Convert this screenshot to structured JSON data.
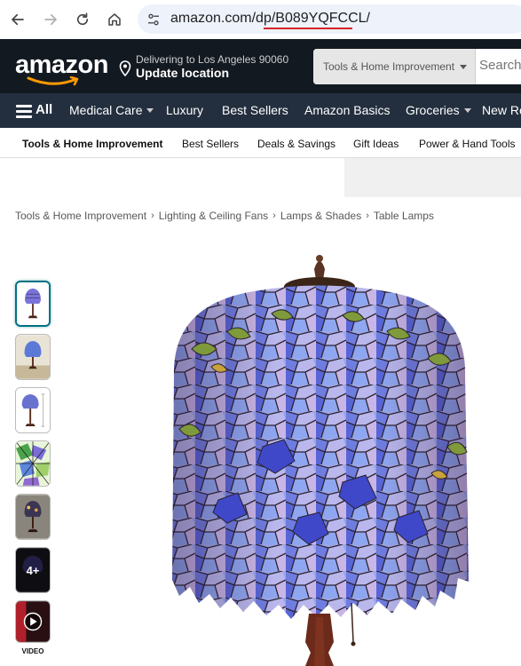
{
  "browser": {
    "url_prefix": "amazon.com/dp/",
    "url_asin": "B089YQFCCL/"
  },
  "header": {
    "logo": "amazon",
    "deliver_line1": "Delivering to Los Angeles 90060",
    "deliver_line2": "Update location",
    "search_category": "Tools & Home Improvement",
    "search_placeholder": "Search"
  },
  "nav": {
    "all": "All",
    "items": [
      "Medical Care",
      "Luxury",
      "Best Sellers",
      "Amazon Basics",
      "Groceries",
      "New Re"
    ]
  },
  "sub_nav": {
    "items": [
      "Tools & Home Improvement",
      "Best Sellers",
      "Deals & Savings",
      "Gift Ideas",
      "Power & Hand Tools"
    ]
  },
  "breadcrumb": [
    "Tools & Home Improvement",
    "Lighting & Ceiling Fans",
    "Lamps & Shades",
    "Table Lamps"
  ],
  "thumbnails": {
    "more_label": "4+",
    "video_label": "VIDEO"
  },
  "colors": {
    "header_bg": "#131921",
    "nav_bg": "#232f3e",
    "accent": "#ff9900",
    "url_highlight": "#d8232a"
  }
}
